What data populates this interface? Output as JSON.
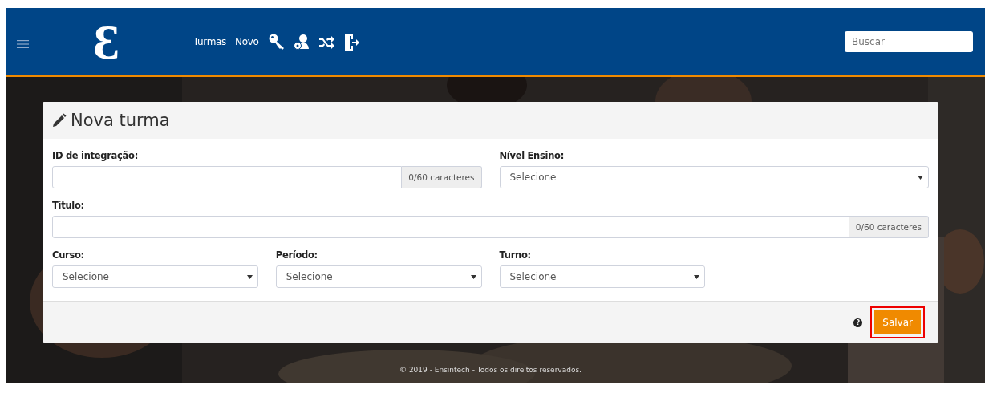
{
  "navbar": {
    "brand": "Ɛ",
    "links": [
      "Turmas",
      "Novo"
    ],
    "icons": [
      {
        "kind": "key"
      },
      {
        "kind": "user-gear"
      },
      {
        "kind": "shuffle"
      },
      {
        "kind": "exit"
      }
    ],
    "search": {
      "placeholder": "Buscar"
    }
  },
  "form": {
    "title": "Nova turma",
    "fields": [
      {
        "kind": "text",
        "label": "ID de integração:",
        "counter": "0/60 caracteres"
      },
      {
        "kind": "select",
        "label": "Nível Ensino:",
        "placeholder": "Selecione"
      },
      {
        "kind": "text",
        "label": "Titulo:",
        "counter": "0/60 caracteres"
      },
      {
        "kind": "select",
        "label": "Curso:",
        "placeholder": "Selecione"
      },
      {
        "kind": "select",
        "label": "Período:",
        "placeholder": "Selecione"
      },
      {
        "kind": "select",
        "label": "Turno:",
        "placeholder": "Selecione"
      }
    ],
    "help": "?",
    "save": {
      "label": "Salvar",
      "highlighted": true
    }
  },
  "footer": "© 2019 - Ensintech - Todos os direitos reservados."
}
